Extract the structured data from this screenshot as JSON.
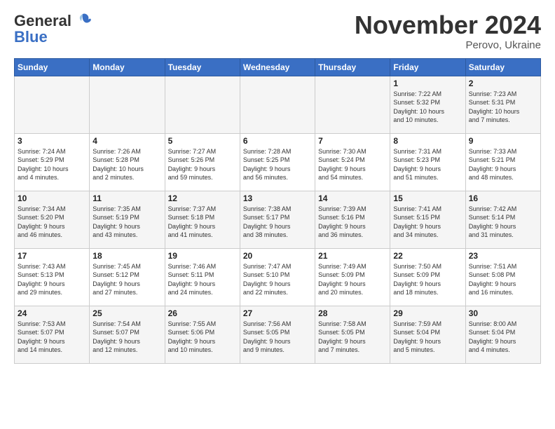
{
  "logo": {
    "text_general": "General",
    "text_blue": "Blue"
  },
  "title": "November 2024",
  "location": "Perovo, Ukraine",
  "days_of_week": [
    "Sunday",
    "Monday",
    "Tuesday",
    "Wednesday",
    "Thursday",
    "Friday",
    "Saturday"
  ],
  "weeks": [
    [
      {
        "day": "",
        "info": ""
      },
      {
        "day": "",
        "info": ""
      },
      {
        "day": "",
        "info": ""
      },
      {
        "day": "",
        "info": ""
      },
      {
        "day": "",
        "info": ""
      },
      {
        "day": "1",
        "info": "Sunrise: 7:22 AM\nSunset: 5:32 PM\nDaylight: 10 hours\nand 10 minutes."
      },
      {
        "day": "2",
        "info": "Sunrise: 7:23 AM\nSunset: 5:31 PM\nDaylight: 10 hours\nand 7 minutes."
      }
    ],
    [
      {
        "day": "3",
        "info": "Sunrise: 7:24 AM\nSunset: 5:29 PM\nDaylight: 10 hours\nand 4 minutes."
      },
      {
        "day": "4",
        "info": "Sunrise: 7:26 AM\nSunset: 5:28 PM\nDaylight: 10 hours\nand 2 minutes."
      },
      {
        "day": "5",
        "info": "Sunrise: 7:27 AM\nSunset: 5:26 PM\nDaylight: 9 hours\nand 59 minutes."
      },
      {
        "day": "6",
        "info": "Sunrise: 7:28 AM\nSunset: 5:25 PM\nDaylight: 9 hours\nand 56 minutes."
      },
      {
        "day": "7",
        "info": "Sunrise: 7:30 AM\nSunset: 5:24 PM\nDaylight: 9 hours\nand 54 minutes."
      },
      {
        "day": "8",
        "info": "Sunrise: 7:31 AM\nSunset: 5:23 PM\nDaylight: 9 hours\nand 51 minutes."
      },
      {
        "day": "9",
        "info": "Sunrise: 7:33 AM\nSunset: 5:21 PM\nDaylight: 9 hours\nand 48 minutes."
      }
    ],
    [
      {
        "day": "10",
        "info": "Sunrise: 7:34 AM\nSunset: 5:20 PM\nDaylight: 9 hours\nand 46 minutes."
      },
      {
        "day": "11",
        "info": "Sunrise: 7:35 AM\nSunset: 5:19 PM\nDaylight: 9 hours\nand 43 minutes."
      },
      {
        "day": "12",
        "info": "Sunrise: 7:37 AM\nSunset: 5:18 PM\nDaylight: 9 hours\nand 41 minutes."
      },
      {
        "day": "13",
        "info": "Sunrise: 7:38 AM\nSunset: 5:17 PM\nDaylight: 9 hours\nand 38 minutes."
      },
      {
        "day": "14",
        "info": "Sunrise: 7:39 AM\nSunset: 5:16 PM\nDaylight: 9 hours\nand 36 minutes."
      },
      {
        "day": "15",
        "info": "Sunrise: 7:41 AM\nSunset: 5:15 PM\nDaylight: 9 hours\nand 34 minutes."
      },
      {
        "day": "16",
        "info": "Sunrise: 7:42 AM\nSunset: 5:14 PM\nDaylight: 9 hours\nand 31 minutes."
      }
    ],
    [
      {
        "day": "17",
        "info": "Sunrise: 7:43 AM\nSunset: 5:13 PM\nDaylight: 9 hours\nand 29 minutes."
      },
      {
        "day": "18",
        "info": "Sunrise: 7:45 AM\nSunset: 5:12 PM\nDaylight: 9 hours\nand 27 minutes."
      },
      {
        "day": "19",
        "info": "Sunrise: 7:46 AM\nSunset: 5:11 PM\nDaylight: 9 hours\nand 24 minutes."
      },
      {
        "day": "20",
        "info": "Sunrise: 7:47 AM\nSunset: 5:10 PM\nDaylight: 9 hours\nand 22 minutes."
      },
      {
        "day": "21",
        "info": "Sunrise: 7:49 AM\nSunset: 5:09 PM\nDaylight: 9 hours\nand 20 minutes."
      },
      {
        "day": "22",
        "info": "Sunrise: 7:50 AM\nSunset: 5:09 PM\nDaylight: 9 hours\nand 18 minutes."
      },
      {
        "day": "23",
        "info": "Sunrise: 7:51 AM\nSunset: 5:08 PM\nDaylight: 9 hours\nand 16 minutes."
      }
    ],
    [
      {
        "day": "24",
        "info": "Sunrise: 7:53 AM\nSunset: 5:07 PM\nDaylight: 9 hours\nand 14 minutes."
      },
      {
        "day": "25",
        "info": "Sunrise: 7:54 AM\nSunset: 5:07 PM\nDaylight: 9 hours\nand 12 minutes."
      },
      {
        "day": "26",
        "info": "Sunrise: 7:55 AM\nSunset: 5:06 PM\nDaylight: 9 hours\nand 10 minutes."
      },
      {
        "day": "27",
        "info": "Sunrise: 7:56 AM\nSunset: 5:05 PM\nDaylight: 9 hours\nand 9 minutes."
      },
      {
        "day": "28",
        "info": "Sunrise: 7:58 AM\nSunset: 5:05 PM\nDaylight: 9 hours\nand 7 minutes."
      },
      {
        "day": "29",
        "info": "Sunrise: 7:59 AM\nSunset: 5:04 PM\nDaylight: 9 hours\nand 5 minutes."
      },
      {
        "day": "30",
        "info": "Sunrise: 8:00 AM\nSunset: 5:04 PM\nDaylight: 9 hours\nand 4 minutes."
      }
    ]
  ]
}
